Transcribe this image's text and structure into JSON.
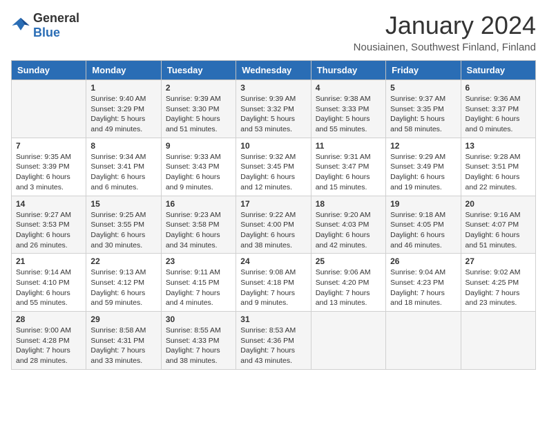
{
  "header": {
    "logo_line1": "General",
    "logo_line2": "Blue",
    "month_title": "January 2024",
    "location": "Nousiainen, Southwest Finland, Finland"
  },
  "weekdays": [
    "Sunday",
    "Monday",
    "Tuesday",
    "Wednesday",
    "Thursday",
    "Friday",
    "Saturday"
  ],
  "weeks": [
    [
      {
        "day": "",
        "sunrise": "",
        "sunset": "",
        "daylight": ""
      },
      {
        "day": "1",
        "sunrise": "Sunrise: 9:40 AM",
        "sunset": "Sunset: 3:29 PM",
        "daylight": "Daylight: 5 hours and 49 minutes."
      },
      {
        "day": "2",
        "sunrise": "Sunrise: 9:39 AM",
        "sunset": "Sunset: 3:30 PM",
        "daylight": "Daylight: 5 hours and 51 minutes."
      },
      {
        "day": "3",
        "sunrise": "Sunrise: 9:39 AM",
        "sunset": "Sunset: 3:32 PM",
        "daylight": "Daylight: 5 hours and 53 minutes."
      },
      {
        "day": "4",
        "sunrise": "Sunrise: 9:38 AM",
        "sunset": "Sunset: 3:33 PM",
        "daylight": "Daylight: 5 hours and 55 minutes."
      },
      {
        "day": "5",
        "sunrise": "Sunrise: 9:37 AM",
        "sunset": "Sunset: 3:35 PM",
        "daylight": "Daylight: 5 hours and 58 minutes."
      },
      {
        "day": "6",
        "sunrise": "Sunrise: 9:36 AM",
        "sunset": "Sunset: 3:37 PM",
        "daylight": "Daylight: 6 hours and 0 minutes."
      }
    ],
    [
      {
        "day": "7",
        "sunrise": "Sunrise: 9:35 AM",
        "sunset": "Sunset: 3:39 PM",
        "daylight": "Daylight: 6 hours and 3 minutes."
      },
      {
        "day": "8",
        "sunrise": "Sunrise: 9:34 AM",
        "sunset": "Sunset: 3:41 PM",
        "daylight": "Daylight: 6 hours and 6 minutes."
      },
      {
        "day": "9",
        "sunrise": "Sunrise: 9:33 AM",
        "sunset": "Sunset: 3:43 PM",
        "daylight": "Daylight: 6 hours and 9 minutes."
      },
      {
        "day": "10",
        "sunrise": "Sunrise: 9:32 AM",
        "sunset": "Sunset: 3:45 PM",
        "daylight": "Daylight: 6 hours and 12 minutes."
      },
      {
        "day": "11",
        "sunrise": "Sunrise: 9:31 AM",
        "sunset": "Sunset: 3:47 PM",
        "daylight": "Daylight: 6 hours and 15 minutes."
      },
      {
        "day": "12",
        "sunrise": "Sunrise: 9:29 AM",
        "sunset": "Sunset: 3:49 PM",
        "daylight": "Daylight: 6 hours and 19 minutes."
      },
      {
        "day": "13",
        "sunrise": "Sunrise: 9:28 AM",
        "sunset": "Sunset: 3:51 PM",
        "daylight": "Daylight: 6 hours and 22 minutes."
      }
    ],
    [
      {
        "day": "14",
        "sunrise": "Sunrise: 9:27 AM",
        "sunset": "Sunset: 3:53 PM",
        "daylight": "Daylight: 6 hours and 26 minutes."
      },
      {
        "day": "15",
        "sunrise": "Sunrise: 9:25 AM",
        "sunset": "Sunset: 3:55 PM",
        "daylight": "Daylight: 6 hours and 30 minutes."
      },
      {
        "day": "16",
        "sunrise": "Sunrise: 9:23 AM",
        "sunset": "Sunset: 3:58 PM",
        "daylight": "Daylight: 6 hours and 34 minutes."
      },
      {
        "day": "17",
        "sunrise": "Sunrise: 9:22 AM",
        "sunset": "Sunset: 4:00 PM",
        "daylight": "Daylight: 6 hours and 38 minutes."
      },
      {
        "day": "18",
        "sunrise": "Sunrise: 9:20 AM",
        "sunset": "Sunset: 4:03 PM",
        "daylight": "Daylight: 6 hours and 42 minutes."
      },
      {
        "day": "19",
        "sunrise": "Sunrise: 9:18 AM",
        "sunset": "Sunset: 4:05 PM",
        "daylight": "Daylight: 6 hours and 46 minutes."
      },
      {
        "day": "20",
        "sunrise": "Sunrise: 9:16 AM",
        "sunset": "Sunset: 4:07 PM",
        "daylight": "Daylight: 6 hours and 51 minutes."
      }
    ],
    [
      {
        "day": "21",
        "sunrise": "Sunrise: 9:14 AM",
        "sunset": "Sunset: 4:10 PM",
        "daylight": "Daylight: 6 hours and 55 minutes."
      },
      {
        "day": "22",
        "sunrise": "Sunrise: 9:13 AM",
        "sunset": "Sunset: 4:12 PM",
        "daylight": "Daylight: 6 hours and 59 minutes."
      },
      {
        "day": "23",
        "sunrise": "Sunrise: 9:11 AM",
        "sunset": "Sunset: 4:15 PM",
        "daylight": "Daylight: 7 hours and 4 minutes."
      },
      {
        "day": "24",
        "sunrise": "Sunrise: 9:08 AM",
        "sunset": "Sunset: 4:18 PM",
        "daylight": "Daylight: 7 hours and 9 minutes."
      },
      {
        "day": "25",
        "sunrise": "Sunrise: 9:06 AM",
        "sunset": "Sunset: 4:20 PM",
        "daylight": "Daylight: 7 hours and 13 minutes."
      },
      {
        "day": "26",
        "sunrise": "Sunrise: 9:04 AM",
        "sunset": "Sunset: 4:23 PM",
        "daylight": "Daylight: 7 hours and 18 minutes."
      },
      {
        "day": "27",
        "sunrise": "Sunrise: 9:02 AM",
        "sunset": "Sunset: 4:25 PM",
        "daylight": "Daylight: 7 hours and 23 minutes."
      }
    ],
    [
      {
        "day": "28",
        "sunrise": "Sunrise: 9:00 AM",
        "sunset": "Sunset: 4:28 PM",
        "daylight": "Daylight: 7 hours and 28 minutes."
      },
      {
        "day": "29",
        "sunrise": "Sunrise: 8:58 AM",
        "sunset": "Sunset: 4:31 PM",
        "daylight": "Daylight: 7 hours and 33 minutes."
      },
      {
        "day": "30",
        "sunrise": "Sunrise: 8:55 AM",
        "sunset": "Sunset: 4:33 PM",
        "daylight": "Daylight: 7 hours and 38 minutes."
      },
      {
        "day": "31",
        "sunrise": "Sunrise: 8:53 AM",
        "sunset": "Sunset: 4:36 PM",
        "daylight": "Daylight: 7 hours and 43 minutes."
      },
      {
        "day": "",
        "sunrise": "",
        "sunset": "",
        "daylight": ""
      },
      {
        "day": "",
        "sunrise": "",
        "sunset": "",
        "daylight": ""
      },
      {
        "day": "",
        "sunrise": "",
        "sunset": "",
        "daylight": ""
      }
    ]
  ]
}
